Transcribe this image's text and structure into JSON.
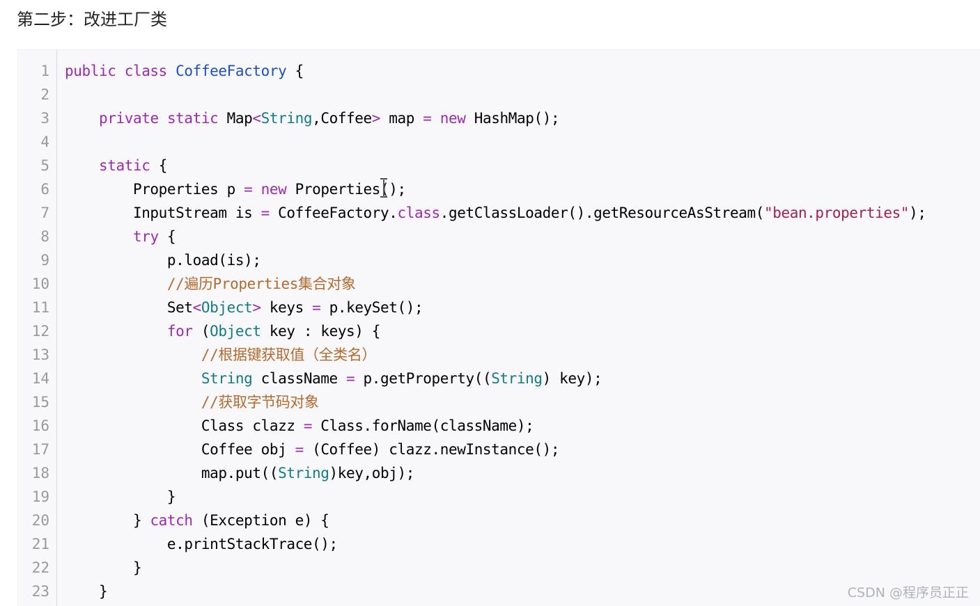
{
  "heading": "第二步：改进工厂类",
  "code_lines": [
    [
      {
        "t": "public ",
        "c": "kw"
      },
      {
        "t": "class ",
        "c": "kw"
      },
      {
        "t": "CoffeeFactory",
        "c": "cls"
      },
      {
        "t": " {",
        "c": ""
      }
    ],
    [],
    [
      {
        "t": "    "
      },
      {
        "t": "private ",
        "c": "kw"
      },
      {
        "t": "static ",
        "c": "kw"
      },
      {
        "t": "Map"
      },
      {
        "t": "<",
        "c": "kw"
      },
      {
        "t": "String",
        "c": "ty"
      },
      {
        "t": ",Coffee"
      },
      {
        "t": ">",
        "c": "kw"
      },
      {
        "t": " map "
      },
      {
        "t": "=",
        "c": "kw"
      },
      {
        "t": " "
      },
      {
        "t": "new ",
        "c": "kw"
      },
      {
        "t": "HashMap();"
      }
    ],
    [],
    [
      {
        "t": "    "
      },
      {
        "t": "static ",
        "c": "kw"
      },
      {
        "t": "{"
      }
    ],
    [
      {
        "t": "        Properties p "
      },
      {
        "t": "=",
        "c": "kw"
      },
      {
        "t": " "
      },
      {
        "t": "new ",
        "c": "kw"
      },
      {
        "t": "Properties();"
      }
    ],
    [
      {
        "t": "        InputStream is "
      },
      {
        "t": "=",
        "c": "kw"
      },
      {
        "t": " CoffeeFactory."
      },
      {
        "t": "class",
        "c": "kw"
      },
      {
        "t": ".getClassLoader().getResourceAsStream("
      },
      {
        "t": "\"bean.properties\"",
        "c": "str"
      },
      {
        "t": ");"
      }
    ],
    [
      {
        "t": "        "
      },
      {
        "t": "try ",
        "c": "kw"
      },
      {
        "t": "{"
      }
    ],
    [
      {
        "t": "            p.load(is);"
      }
    ],
    [
      {
        "t": "            //遍历Properties集合对象",
        "c": "cm"
      }
    ],
    [
      {
        "t": "            Set"
      },
      {
        "t": "<",
        "c": "kw"
      },
      {
        "t": "Object",
        "c": "ty"
      },
      {
        "t": ">",
        "c": "kw"
      },
      {
        "t": " keys "
      },
      {
        "t": "=",
        "c": "kw"
      },
      {
        "t": " p.keySet();"
      }
    ],
    [
      {
        "t": "            "
      },
      {
        "t": "for ",
        "c": "kw"
      },
      {
        "t": "("
      },
      {
        "t": "Object",
        "c": "ty"
      },
      {
        "t": " key : keys) {"
      }
    ],
    [
      {
        "t": "                //根据键获取值（全类名）",
        "c": "cm"
      }
    ],
    [
      {
        "t": "                "
      },
      {
        "t": "String",
        "c": "ty"
      },
      {
        "t": " className "
      },
      {
        "t": "=",
        "c": "kw"
      },
      {
        "t": " p.getProperty(("
      },
      {
        "t": "String",
        "c": "ty"
      },
      {
        "t": ") key);"
      }
    ],
    [
      {
        "t": "                //获取字节码对象",
        "c": "cm"
      }
    ],
    [
      {
        "t": "                Class clazz "
      },
      {
        "t": "=",
        "c": "kw"
      },
      {
        "t": " Class.forName(className);"
      }
    ],
    [
      {
        "t": "                Coffee obj "
      },
      {
        "t": "=",
        "c": "kw"
      },
      {
        "t": " (Coffee) clazz.newInstance();"
      }
    ],
    [
      {
        "t": "                map.put(("
      },
      {
        "t": "String",
        "c": "ty"
      },
      {
        "t": ")key,obj);"
      }
    ],
    [
      {
        "t": "            }"
      }
    ],
    [
      {
        "t": "        } "
      },
      {
        "t": "catch ",
        "c": "kw"
      },
      {
        "t": "(Exception e) {"
      }
    ],
    [
      {
        "t": "            e.printStackTrace();"
      }
    ],
    [
      {
        "t": "        }"
      }
    ],
    [
      {
        "t": "    }"
      }
    ]
  ],
  "line_numbers": [
    "1",
    "2",
    "3",
    "4",
    "5",
    "6",
    "7",
    "8",
    "9",
    "10",
    "11",
    "12",
    "13",
    "14",
    "15",
    "16",
    "17",
    "18",
    "19",
    "20",
    "21",
    "22",
    "23"
  ],
  "watermark": "CSDN @程序员正正",
  "colors": {
    "keyword": "#9c2ab0",
    "type": "#0f7c86",
    "class_name": "#1d4fbf",
    "string": "#a3204a",
    "comment": "#b46a2e",
    "code_bg": "#f8f8fb"
  },
  "icons": {
    "cursor": "text-cursor-icon"
  }
}
